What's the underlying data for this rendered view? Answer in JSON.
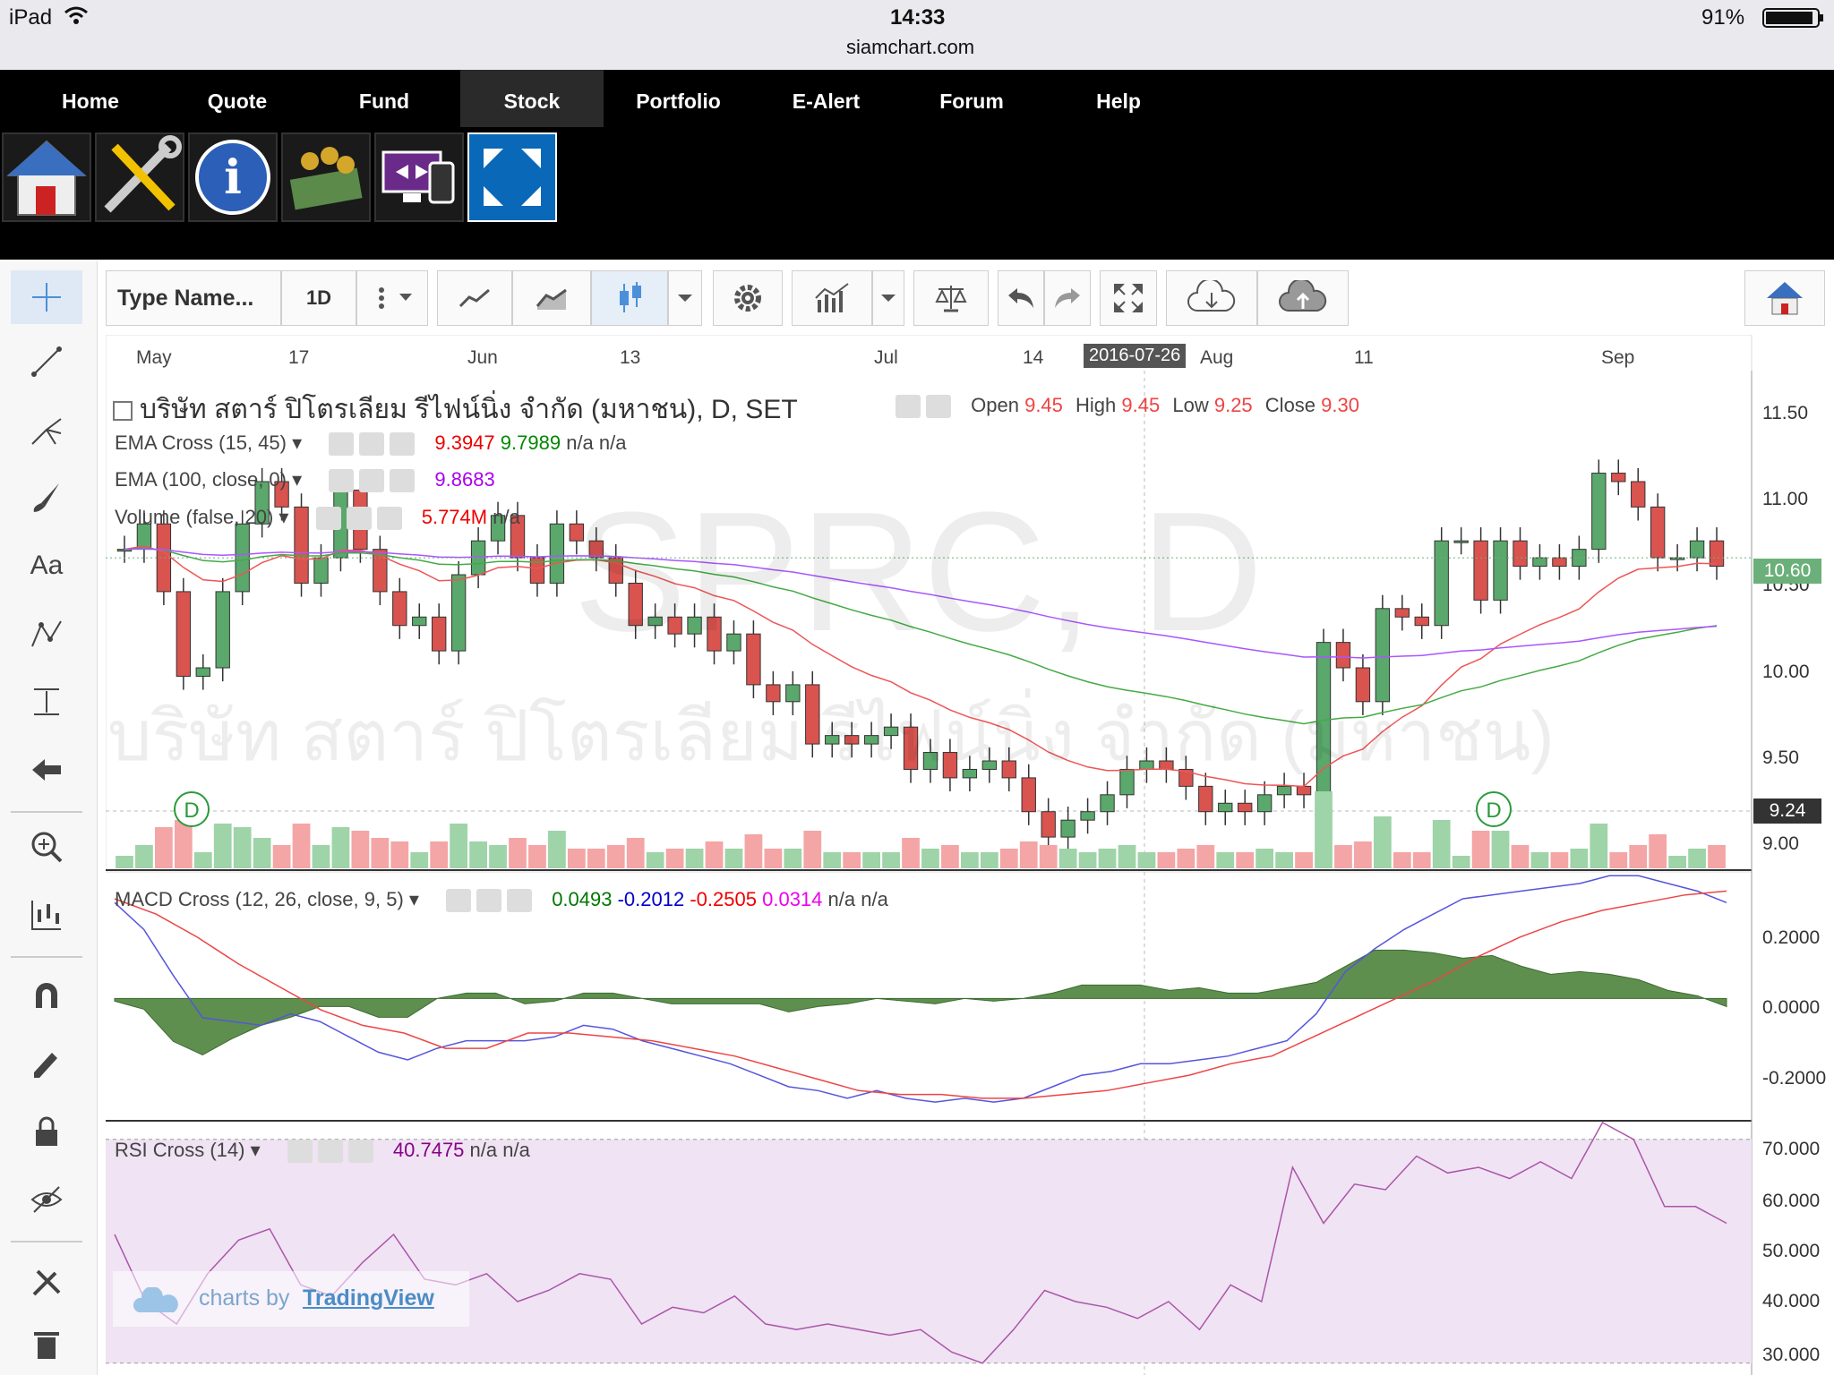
{
  "status_bar": {
    "device": "iPad",
    "time": "14:33",
    "battery": "91%",
    "url": "siamchart.com"
  },
  "nav": {
    "items": [
      "Home",
      "Quote",
      "Fund",
      "Stock",
      "Portfolio",
      "E-Alert",
      "Forum",
      "Help"
    ],
    "active": "Stock"
  },
  "toolbar": {
    "symbol_placeholder": "Type Name...",
    "interval": "1D"
  },
  "chart": {
    "symbol_title": "บริษัท สตาร์ ปิโตรเลียม รีไฟน์นิ่ง จำกัด (มหาชน), D, SET",
    "ohlc": {
      "open_label": "Open",
      "open": "9.45",
      "high_label": "High",
      "high": "9.45",
      "low_label": "Low",
      "low": "9.25",
      "close_label": "Close",
      "close": "9.30"
    },
    "watermark_symbol": "SPRC, D",
    "watermark_name": "บริษัท สตาร์ ปิโตรเลียม รีไฟน์นิ่ง จำกัด (มหาชน)",
    "ema_cross": {
      "label": "EMA Cross (15, 45)",
      "v1": "9.3947",
      "v2": "9.7989",
      "v3": "n/a",
      "v4": "n/a"
    },
    "ema": {
      "label": "EMA (100, close, 0)",
      "v1": "9.8683"
    },
    "volume": {
      "label": "Volume (false, 20)",
      "v1": "5.774M",
      "v2": "n/a"
    },
    "macd": {
      "label": "MACD Cross (12, 26, close, 9, 5)",
      "v1": "0.0493",
      "v2": "-0.2012",
      "v3": "-0.2505",
      "v4": "0.0314",
      "v5": "n/a",
      "v6": "n/a"
    },
    "rsi": {
      "label": "RSI Cross (14)",
      "v1": "40.7475",
      "v2": "n/a",
      "v3": "n/a"
    },
    "crosshair_date": "2016-07-26",
    "last_price": "10.60",
    "crosshair_price": "9.24",
    "dividend_marker": "D",
    "credit_text": "charts by",
    "credit_link": "TradingView",
    "colors": {
      "up": "#5aa86b",
      "down": "#d9534f",
      "ema_fast": "#e55",
      "ema_slow": "#4a4",
      "ema100": "#a5f",
      "macd": "#55d",
      "signal": "#e44",
      "hist": "#5e8f4e",
      "rsi": "#a5a"
    }
  },
  "chart_data": [
    {
      "type": "candlestick",
      "title": "SPRC, D",
      "x_ticks": [
        "May",
        "17",
        "Jun",
        "13",
        "Jul",
        "14",
        "Aug",
        "11",
        "Sep"
      ],
      "y_ticks": [
        "11.50",
        "11.00",
        "10.50",
        "10.00",
        "9.50",
        "9.00"
      ],
      "ylim": [
        8.85,
        11.6
      ],
      "series": [
        {
          "name": "Price",
          "close": [
            10.65,
            10.8,
            10.4,
            9.9,
            9.95,
            10.4,
            10.8,
            11.05,
            10.9,
            10.45,
            10.6,
            11.0,
            10.65,
            10.4,
            10.2,
            10.25,
            10.05,
            10.5,
            10.7,
            10.85,
            10.6,
            10.45,
            10.8,
            10.7,
            10.6,
            10.45,
            10.2,
            10.25,
            10.15,
            10.25,
            10.05,
            10.15,
            9.85,
            9.75,
            9.85,
            9.5,
            9.55,
            9.5,
            9.55,
            9.6,
            9.35,
            9.45,
            9.3,
            9.35,
            9.4,
            9.3,
            9.1,
            8.95,
            9.05,
            9.1,
            9.2,
            9.35,
            9.4,
            9.35,
            9.25,
            9.1,
            9.15,
            9.1,
            9.2,
            9.25,
            9.2,
            10.1,
            9.95,
            9.75,
            10.3,
            10.25,
            10.2,
            10.7,
            10.7,
            10.35,
            10.7,
            10.55,
            10.6,
            10.55,
            10.65,
            11.1,
            11.05,
            10.9,
            10.6,
            10.6,
            10.7,
            10.55
          ]
        }
      ]
    },
    {
      "type": "line",
      "title": "MACD Cross (12, 26, close, 9, 5)",
      "y_ticks": [
        "0.2000",
        "0.0000",
        "-0.2000"
      ],
      "ylim": [
        -0.3,
        0.33
      ],
      "series": [
        {
          "name": "MACD",
          "values": [
            0.25,
            0.18,
            0.06,
            -0.05,
            -0.06,
            -0.07,
            -0.04,
            -0.06,
            -0.1,
            -0.14,
            -0.16,
            -0.13,
            -0.11,
            -0.11,
            -0.11,
            -0.1,
            -0.07,
            -0.08,
            -0.11,
            -0.13,
            -0.15,
            -0.17,
            -0.2,
            -0.23,
            -0.24,
            -0.26,
            -0.24,
            -0.26,
            -0.27,
            -0.26,
            -0.27,
            -0.26,
            -0.23,
            -0.2,
            -0.19,
            -0.17,
            -0.17,
            -0.16,
            -0.15,
            -0.13,
            -0.11,
            -0.04,
            0.07,
            0.13,
            0.18,
            0.22,
            0.26,
            0.27,
            0.28,
            0.29,
            0.3,
            0.32,
            0.32,
            0.3,
            0.28,
            0.25
          ]
        },
        {
          "name": "Signal",
          "values": [
            0.26,
            0.22,
            0.16,
            0.09,
            0.03,
            -0.03,
            -0.07,
            -0.09,
            -0.13,
            -0.13,
            -0.09,
            -0.09,
            -0.1,
            -0.11,
            -0.13,
            -0.15,
            -0.18,
            -0.21,
            -0.24,
            -0.25,
            -0.25,
            -0.26,
            -0.26,
            -0.25,
            -0.24,
            -0.22,
            -0.2,
            -0.17,
            -0.15,
            -0.1,
            -0.05,
            0.0,
            0.05,
            0.11,
            0.16,
            0.2,
            0.23,
            0.25,
            0.27,
            0.28
          ]
        }
      ]
    },
    {
      "type": "line",
      "title": "RSI Cross (14)",
      "y_ticks": [
        "70.000",
        "60.000",
        "50.000",
        "40.000",
        "30.000"
      ],
      "ylim": [
        29,
        73
      ],
      "series": [
        {
          "name": "RSI",
          "values": [
            53,
            41,
            37,
            46,
            52,
            54,
            44,
            42,
            48,
            53,
            45,
            44,
            46,
            41,
            43,
            46,
            45,
            37,
            40,
            39,
            42,
            37,
            36,
            37,
            36,
            35,
            36,
            32,
            30,
            36,
            43,
            41,
            40,
            38,
            41,
            36,
            44,
            41,
            65,
            55,
            62,
            61,
            67,
            64,
            65,
            63,
            66,
            63,
            73,
            70,
            58,
            58,
            55
          ]
        }
      ]
    }
  ]
}
